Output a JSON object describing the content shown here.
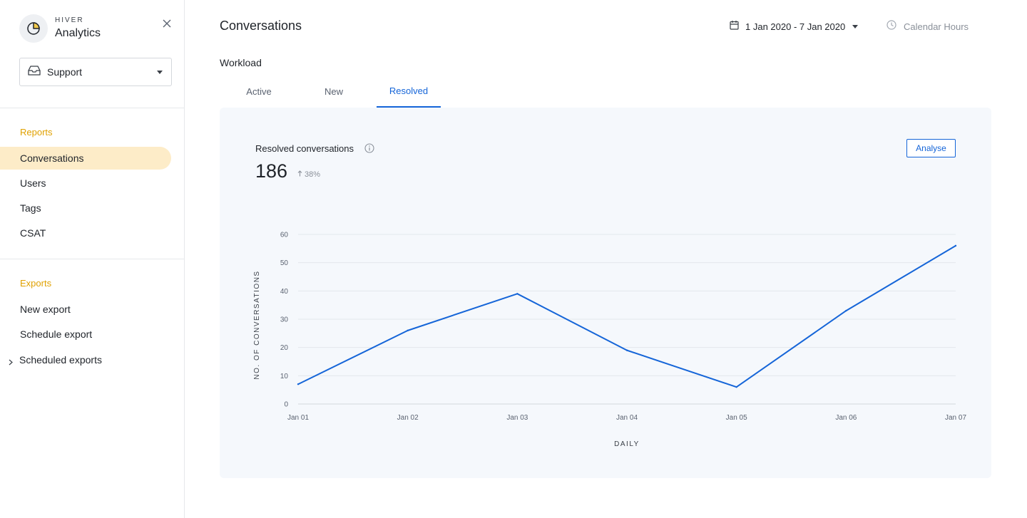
{
  "sidebar": {
    "brand_small": "HIVER",
    "brand_big": "Analytics",
    "team_select": "Support",
    "reports_title": "Reports",
    "reports": [
      {
        "label": "Conversations"
      },
      {
        "label": "Users"
      },
      {
        "label": "Tags"
      },
      {
        "label": "CSAT"
      }
    ],
    "exports_title": "Exports",
    "exports": [
      {
        "label": "New export"
      },
      {
        "label": "Schedule export"
      },
      {
        "label": "Scheduled exports"
      }
    ]
  },
  "header": {
    "title": "Conversations",
    "date_range": "1 Jan 2020 - 7 Jan 2020",
    "calendar_hours": "Calendar Hours"
  },
  "workload": {
    "title": "Workload",
    "tabs": [
      {
        "label": "Active"
      },
      {
        "label": "New"
      },
      {
        "label": "Resolved"
      }
    ],
    "active_tab": "Resolved"
  },
  "panel": {
    "title": "Resolved conversations",
    "value": "186",
    "change": "38%",
    "analyse_label": "Analyse"
  },
  "colors": {
    "accent": "#1565d8",
    "section": "#e0a100",
    "active_nav_bg": "#fdecc8",
    "panel_bg": "#f5f8fc"
  },
  "chart_data": {
    "type": "line",
    "categories": [
      "Jan 01",
      "Jan 02",
      "Jan 03",
      "Jan 04",
      "Jan 05",
      "Jan 06",
      "Jan 07"
    ],
    "series": [
      {
        "values": [
          7,
          26,
          39,
          19,
          6,
          33,
          56
        ]
      }
    ],
    "ylim": [
      0,
      60
    ],
    "yticks": [
      0,
      10,
      20,
      30,
      40,
      50,
      60
    ],
    "xlabel": "DAILY",
    "ylabel": "NO. OF CONVERSATIONS",
    "grid": true
  }
}
